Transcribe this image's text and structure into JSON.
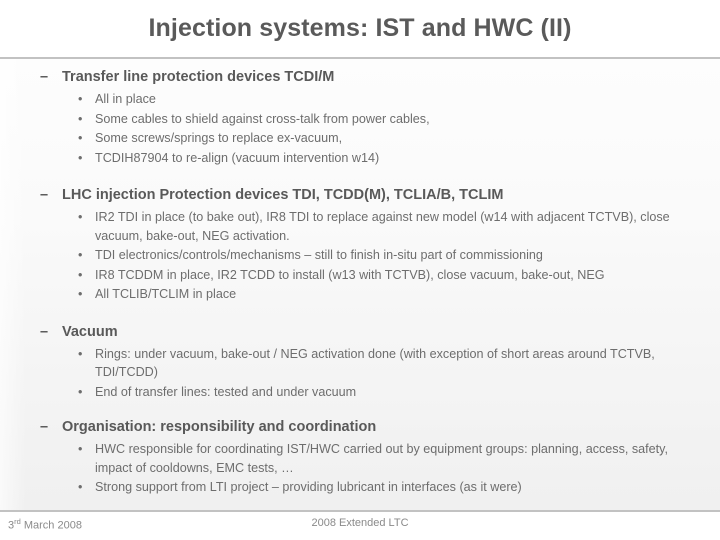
{
  "slide": {
    "title": "Injection systems: IST and HWC (II)",
    "dash_marker": "–",
    "dot_marker": "•",
    "accent_color": "#c2c2c2",
    "title_color": "#5a5a5a",
    "heading_color": "#595959",
    "body_color": "#6d6d6d"
  },
  "sections": [
    {
      "heading": "Transfer line protection devices TCDI/M",
      "bullets": [
        "All in place",
        "Some cables to shield against cross-talk from power cables,",
        "Some screws/springs to replace ex-vacuum,",
        "TCDIH87904 to re-align (vacuum intervention w14)"
      ]
    },
    {
      "heading": "LHC injection Protection devices TDI, TCDD(M), TCLIA/B, TCLIM",
      "bullets": [
        "IR2 TDI in place (to bake out), IR8 TDI to replace against new model (w14 with adjacent TCTVB), close vacuum, bake-out, NEG activation.",
        "TDI electronics/controls/mechanisms – still to finish in-situ part of commissioning",
        "IR8 TCDDM in place, IR2 TCDD to install (w13 with TCTVB), close vacuum, bake-out, NEG",
        "All TCLIB/TCLIM in place"
      ]
    },
    {
      "heading": "Vacuum",
      "bullets": [
        "Rings: under vacuum, bake-out / NEG activation done  (with exception of short areas around TCTVB, TDI/TCDD)",
        "End of transfer lines: tested and under vacuum"
      ]
    },
    {
      "heading": "Organisation: responsibility and coordination",
      "bullets": [
        "HWC responsible for coordinating IST/HWC carried out by equipment groups: planning, access, safety, impact of cooldowns, EMC tests, …",
        "Strong support from LTI project – providing lubricant in interfaces (as it were)"
      ]
    }
  ],
  "footer": {
    "date_number": "3",
    "date_ordinal": "rd",
    "date_rest": " March 2008",
    "center": "2008 Extended LTC"
  }
}
